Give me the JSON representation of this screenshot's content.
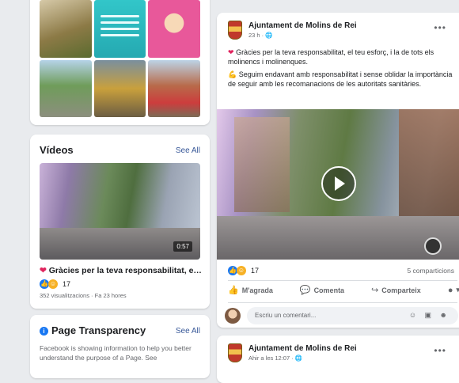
{
  "left": {
    "videos": {
      "title": "Vídeos",
      "see_all": "See All",
      "duration": "0:57",
      "caption": "Gràcies per la teva responsabilitat, el...",
      "reaction_count": "17",
      "views": "352 visualitzacions · Fa 23 hores"
    },
    "transparency": {
      "title": "Page Transparency",
      "see_all": "See All",
      "text": "Facebook is showing information to help you better understand the purpose of a Page. See"
    }
  },
  "post": {
    "page_name": "Ajuntament de Molins de Rei",
    "time": "23 h · ",
    "text1": "Gràcies per la teva responsabilitat, el teu esforç, i la de tots els molinencs i molinenques.",
    "text2": "Seguim endavant amb responsabilitat i sense oblidar la importància de seguir amb les recomanacions de les autoritats sanitàries.",
    "reaction_count": "17",
    "shares": "5 comparticions",
    "actions": {
      "like": "M'agrada",
      "comment": "Comenta",
      "share": "Comparteix"
    },
    "comment_placeholder": "Escriu un comentari..."
  },
  "post2": {
    "page_name": "Ajuntament de Molins de Rei",
    "time": "Ahir a les 12:07 · "
  },
  "colors": {
    "accent": "#1877f2",
    "link": "#385898",
    "heart": "#e0245e",
    "background": "#e9ebee"
  }
}
